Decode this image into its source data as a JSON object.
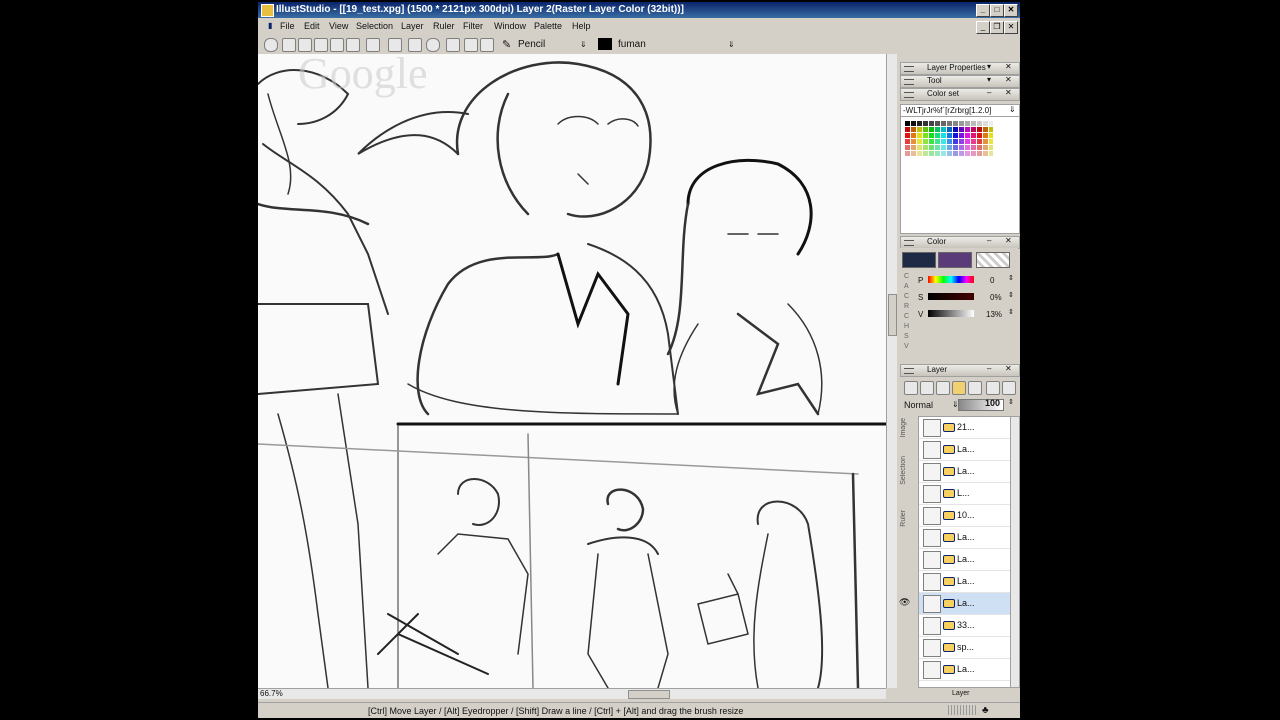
{
  "window": {
    "title": "IllustStudio - [[19_test.xpg] (1500 * 2121px 300dpi)   Layer 2(Raster Layer Color (32bit))]"
  },
  "menu": {
    "items": [
      "File",
      "Edit",
      "View",
      "Selection",
      "Layer",
      "Ruler",
      "Filter",
      "Window",
      "Palette",
      "Help"
    ]
  },
  "toolbar": {
    "tool_name": "Pencil",
    "color_name": "fuman"
  },
  "watermark": "Google",
  "panels": {
    "layer_properties": "Layer Properties",
    "tool": "Tool",
    "color_set": "Color set",
    "color_set_name": "-WLTjrJr%f`[rZrbrg[1.2.0]",
    "color": "Color",
    "layer": "Layer"
  },
  "color": {
    "main": "#1f2a44",
    "sub": "#5a3a78",
    "channels": [
      {
        "label": "P",
        "value": "0"
      },
      {
        "label": "S",
        "value": "0%"
      },
      {
        "label": "V",
        "value": "13%"
      }
    ],
    "side_labels": [
      "C",
      "A",
      "C",
      "R",
      "C",
      "H",
      "S",
      "V"
    ]
  },
  "layer_panel": {
    "blend_mode": "Normal",
    "opacity": "100",
    "side_tabs": [
      "Image",
      "Selection",
      "Ruler"
    ],
    "rows": [
      {
        "name": "21...",
        "selected": false,
        "visible": false
      },
      {
        "name": "La...",
        "selected": false,
        "visible": false
      },
      {
        "name": "La...",
        "selected": false,
        "visible": false
      },
      {
        "name": "L...",
        "selected": false,
        "visible": false
      },
      {
        "name": "10...",
        "selected": false,
        "visible": false
      },
      {
        "name": "La...",
        "selected": false,
        "visible": false
      },
      {
        "name": "La...",
        "selected": false,
        "visible": false
      },
      {
        "name": "La...",
        "selected": false,
        "visible": false
      },
      {
        "name": "La...",
        "selected": true,
        "visible": true
      },
      {
        "name": "33...",
        "selected": false,
        "visible": false
      },
      {
        "name": "sp...",
        "selected": false,
        "visible": false
      },
      {
        "name": "La...",
        "selected": false,
        "visible": false
      }
    ],
    "footer_label": "Layer"
  },
  "status": {
    "zoom": "66.7%",
    "hint": "[Ctrl] Move Layer / [Alt] Eyedropper / [Shift] Draw a line / [Ctrl] + [Alt] and drag the brush resize"
  }
}
